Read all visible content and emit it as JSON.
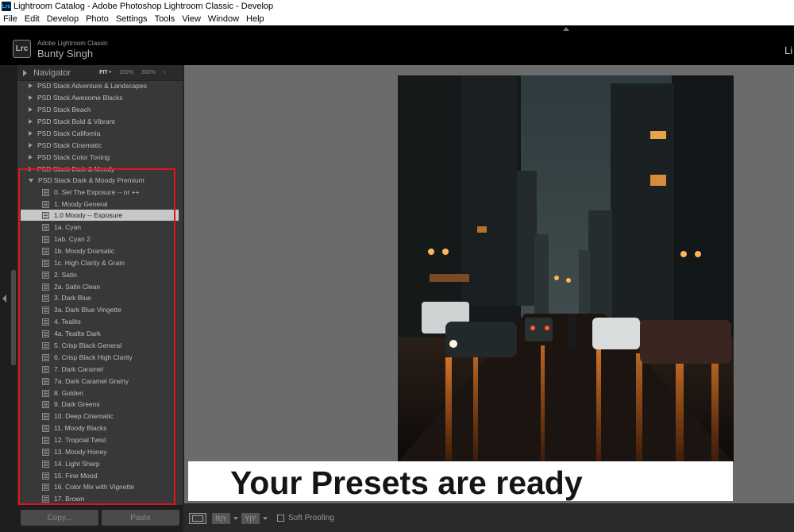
{
  "window": {
    "title": "Lightroom Catalog - Adobe Photoshop Lightroom Classic - Develop",
    "app_icon": "Lrc"
  },
  "menu": [
    "File",
    "Edit",
    "Develop",
    "Photo",
    "Settings",
    "Tools",
    "View",
    "Window",
    "Help"
  ],
  "identity": {
    "logo": "Lrc",
    "product": "Adobe Lightroom Classic",
    "user": "Bunty Singh",
    "module_clipped": "Li"
  },
  "navigator": {
    "title": "Navigator",
    "zoom_fit": "FIT •",
    "zoom_100": "100%",
    "zoom_300": "300%",
    "zoom_updown": "↕"
  },
  "presets": {
    "groups_collapsed": [
      "PSD Stack Adventure & Landscapes",
      "PSD Stack Awesome Blacks",
      "PSD Stack Beach",
      "PSD Stack Bold & Vibrant",
      "PSD Stack California",
      "PSD Stack Cinematic",
      "PSD Stack Color Toning",
      "PSD Stack Dark & Moody"
    ],
    "group_expanded": "PSD Stack Dark & Moody Premium",
    "items": [
      "0. Set The Exposure -- or ++",
      "1. Moody General",
      "1.0 Moody -- Exposure",
      "1a. Cyan",
      "1ab. Cyan 2",
      "1b. Moody Dramatic",
      "1c. High Clarity & Grain",
      "2. Satin",
      "2a. Satin Clean",
      "3. Dark Blue",
      "3a. Dark Blue Vingette",
      "4. Tealite",
      "4a. Teailte Dark",
      "5. Crisp Black General",
      "6. Crisp Black High Clarity",
      "7. Dark Caramel",
      "7a. Dark Caramel Grainy",
      "8. Golden",
      "9. Dark Greens",
      "10. Deep Cinematic",
      "11. Moody Blacks",
      "12. Tropcial Twist",
      "13. Moody Honey",
      "14. Light Sharp",
      "15. Fine Mood",
      "16. Color Mix with Vignette",
      "17. Brown"
    ],
    "selected_item": "1.0 Moody -- Exposure",
    "highlight_color": "#e0141c"
  },
  "buttons": {
    "copy": "Copy...",
    "paste": "Paste"
  },
  "banner": {
    "text": "Your Presets are ready"
  },
  "toolbar": {
    "ry_label": "R|Y",
    "yy_label": "Y|Y",
    "soft_proofing": "Soft Proofing",
    "soft_proofing_checked": false
  },
  "colors": {
    "panel_bg": "#383838",
    "canvas_bg": "#6b6b6b",
    "selected_row_bg": "#c7c7c7"
  }
}
